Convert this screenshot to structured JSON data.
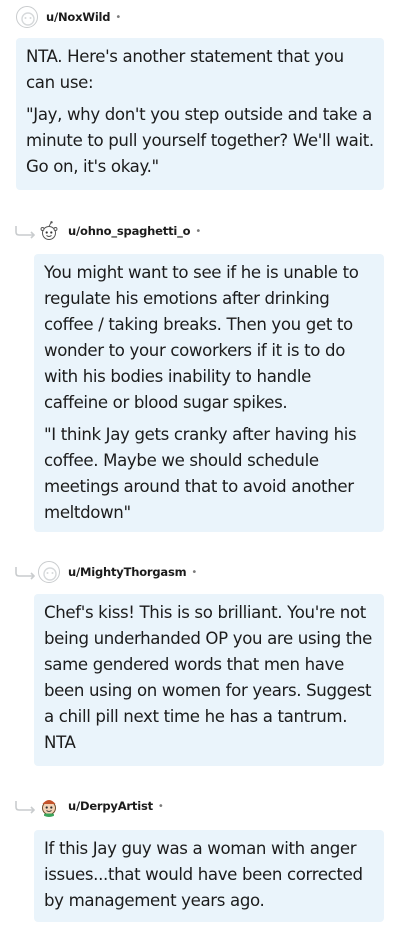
{
  "comments": [
    {
      "username": "u/NoxWild",
      "separator": "•",
      "avatar_icon": "default-avatar-icon",
      "paragraphs": [
        "NTA. Here's another statement that you can use:",
        "\"Jay, why don't you step outside and take a minute to pull yourself together? We'll wait. Go on, it's okay.\""
      ]
    },
    {
      "username": "u/ohno_spaghetti_o",
      "separator": "•",
      "avatar_icon": "snoo-avatar-icon",
      "paragraphs": [
        "You might want to see if he is unable to regulate his emotions after drinking coffee / taking breaks. Then you get to wonder to your coworkers if it is to do with his bodies inability to handle caffeine or blood sugar spikes.",
        "\"I think Jay gets cranky after having his coffee. Maybe we should schedule meetings around that to avoid another meltdown\""
      ]
    },
    {
      "username": "u/MightyThorgasm",
      "separator": "•",
      "avatar_icon": "default-avatar-icon",
      "paragraphs": [
        "Chef's kiss! This is so brilliant. You're not being underhanded OP you are using the same gendered words that men have been using on women for years. Suggest a chill pill next time he has a tantrum. NTA"
      ]
    },
    {
      "username": "u/DerpyArtist",
      "separator": "•",
      "avatar_icon": "snoo-avatar-icon",
      "paragraphs": [
        "If this Jay guy was a woman with anger issues...that would have been corrected by management years ago."
      ]
    }
  ],
  "colors": {
    "bubble_bg": "#eaf4fb",
    "text": "#1c1c1c",
    "meta": "#7c7c7c",
    "thread_line": "#c9ccce"
  }
}
